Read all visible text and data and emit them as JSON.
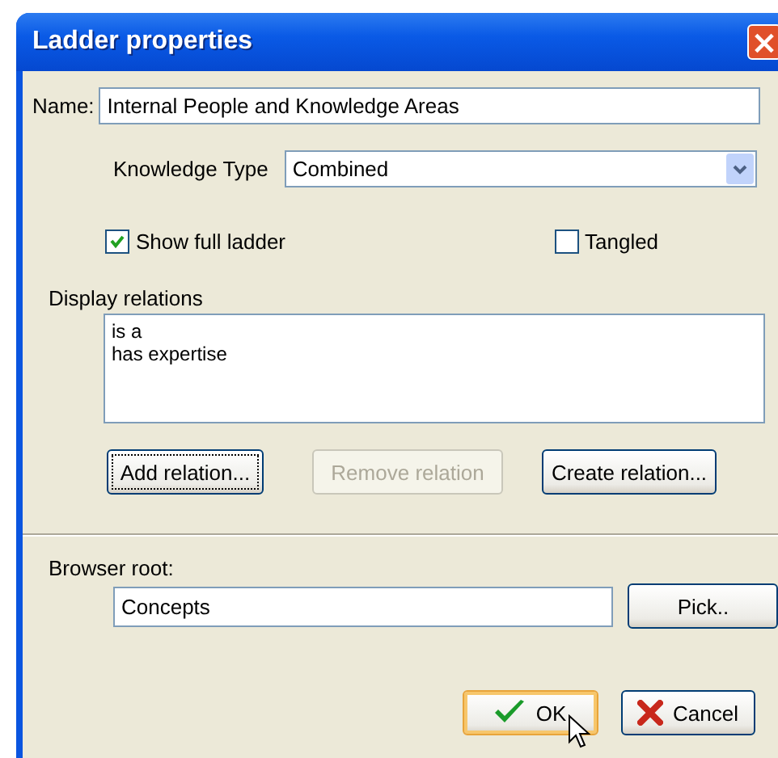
{
  "window": {
    "title": "Ladder properties",
    "close": "×"
  },
  "name": {
    "label": "Name:",
    "value": "Internal People and Knowledge Areas"
  },
  "knowledge_type": {
    "label": "Knowledge Type",
    "value": "Combined"
  },
  "checkboxes": [
    {
      "label": "Show full ladder",
      "checked": true
    },
    {
      "label": "Tangled",
      "checked": false
    }
  ],
  "display_relations": {
    "label": "Display relations",
    "items": [
      "is a",
      "has expertise"
    ]
  },
  "relation_buttons": [
    {
      "label": "Add relation...",
      "disabled": false,
      "focused": true
    },
    {
      "label": "Remove relation",
      "disabled": true,
      "focused": false
    },
    {
      "label": "Create relation...",
      "disabled": false,
      "focused": false
    }
  ],
  "browser_root": {
    "label": "Browser root:",
    "value": "Concepts",
    "button": "Pick.."
  },
  "dialog_buttons": [
    {
      "kind": "ok",
      "label": "OK",
      "default": true
    },
    {
      "kind": "cancel",
      "label": "Cancel",
      "default": false
    }
  ]
}
